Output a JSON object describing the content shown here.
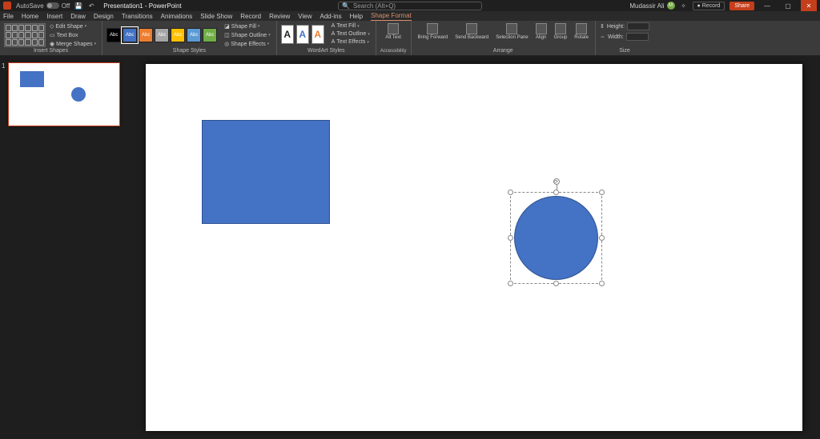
{
  "title_bar": {
    "autosave_label": "AutoSave",
    "autosave_state": "Off",
    "doc_title": "Presentation1 - PowerPoint",
    "search_placeholder": "Search (Alt+Q)",
    "user_name": "Mudassir Ali",
    "record_label": "Record",
    "share_label": "Share"
  },
  "tabs": [
    "File",
    "Home",
    "Insert",
    "Draw",
    "Design",
    "Transitions",
    "Animations",
    "Slide Show",
    "Record",
    "Review",
    "View",
    "Add-ins",
    "Help",
    "Shape Format"
  ],
  "active_tab": "Shape Format",
  "ribbon": {
    "insert_shapes": {
      "label": "Insert Shapes",
      "edit_shape": "Edit Shape",
      "text_box": "Text Box",
      "merge": "Merge Shapes"
    },
    "shape_styles": {
      "label": "Shape Styles",
      "fill": "Shape Fill",
      "outline": "Shape Outline",
      "effects": "Shape Effects",
      "swatches": [
        "#000000",
        "#4472c4",
        "#ed7d31",
        "#a5a5a5",
        "#ffc000",
        "#5b9bd5",
        "#70ad47"
      ],
      "swatch_text": "Abc"
    },
    "wordart": {
      "label": "WordArt Styles",
      "text_fill": "Text Fill",
      "text_outline": "Text Outline",
      "text_effects": "Text Effects",
      "glyph": "A"
    },
    "accessibility": {
      "label": "Accessibility",
      "alt_text": "Alt Text"
    },
    "arrange": {
      "label": "Arrange",
      "bring_forward": "Bring Forward",
      "send_backward": "Send Backward",
      "selection_pane": "Selection Pane",
      "align": "Align",
      "group": "Group",
      "rotate": "Rotate"
    },
    "size": {
      "label": "Size",
      "height_label": "Height:",
      "width_label": "Width:",
      "height_val": "",
      "width_val": ""
    }
  },
  "thumbnail": {
    "number": "1"
  },
  "shapes": {
    "rect": {
      "fill": "#4472c4"
    },
    "circle": {
      "fill": "#4472c4",
      "selected": true
    }
  }
}
